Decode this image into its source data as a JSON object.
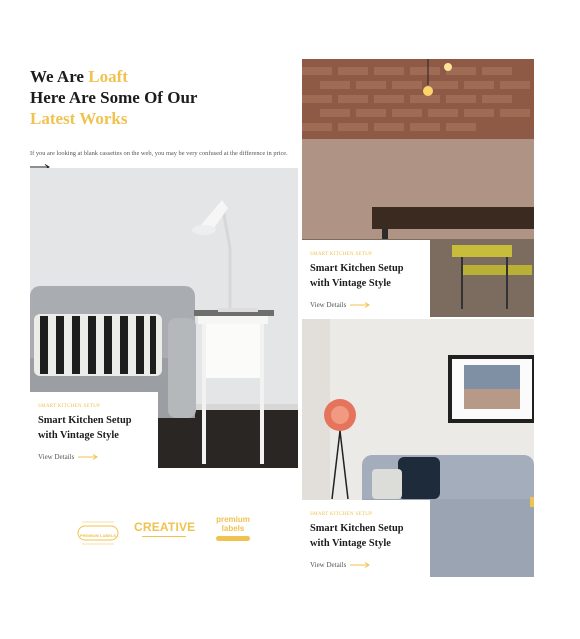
{
  "heading": {
    "line1_prefix": "We Are",
    "brand": "Loaft",
    "line2": "Here Are Some Of Our",
    "line3": "Latest Works"
  },
  "intro": "If you are looking at blank cassettes on the web, you may be very confused at the difference in price.",
  "colors": {
    "accent": "#f0c24f",
    "text": "#1c1c1c"
  },
  "works": [
    {
      "kicker": "SMART KITCHEN SETUP",
      "title": "Smart Kitchen Setup with Vintage Style",
      "link": "View Details"
    },
    {
      "kicker": "SMART KITCHEN SETUP",
      "title": "Smart Kitchen Setup with Vintage Style",
      "link": "View Details"
    },
    {
      "kicker": "SMART KITCHEN SETUP",
      "title": "Smart Kitchen Setup with Vintage Style",
      "link": "View Details"
    }
  ],
  "logos": [
    {
      "text": "PREMIUM LABELS"
    },
    {
      "text": "CREATIVE"
    },
    {
      "text": "premium labels"
    }
  ]
}
